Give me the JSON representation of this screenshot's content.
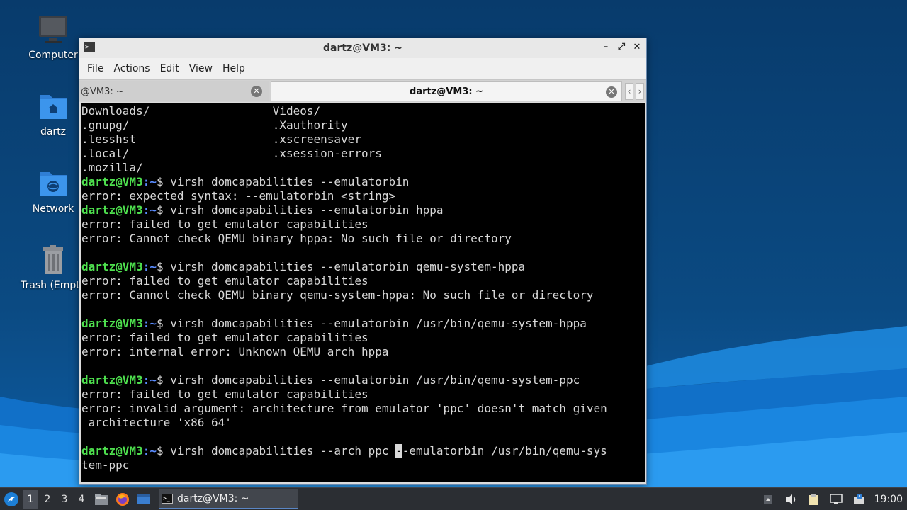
{
  "desktop": {
    "icons": [
      {
        "label": "Computer"
      },
      {
        "label": "dartz"
      },
      {
        "label": "Network"
      },
      {
        "label": "Trash (Empty)"
      }
    ]
  },
  "window": {
    "title": "dartz@VM3: ~",
    "menu": [
      "File",
      "Actions",
      "Edit",
      "View",
      "Help"
    ],
    "tabs": [
      {
        "label": "@VM3: ~",
        "active": false
      },
      {
        "label": "dartz@VM3: ~",
        "active": true
      }
    ],
    "terminal": {
      "user_host": "dartz@VM3",
      "path": ":~",
      "lines": [
        {
          "type": "out",
          "text": "Downloads/                  Videos/"
        },
        {
          "type": "out",
          "text": ".gnupg/                     .Xauthority"
        },
        {
          "type": "out",
          "text": ".lesshst                    .xscreensaver"
        },
        {
          "type": "out",
          "text": ".local/                     .xsession-errors"
        },
        {
          "type": "out",
          "text": ".mozilla/"
        },
        {
          "type": "cmd",
          "text": "$ virsh domcapabilities --emulatorbin"
        },
        {
          "type": "out",
          "text": "error: expected syntax: --emulatorbin <string>"
        },
        {
          "type": "cmd",
          "text": "$ virsh domcapabilities --emulatorbin hppa"
        },
        {
          "type": "out",
          "text": "error: failed to get emulator capabilities"
        },
        {
          "type": "out",
          "text": "error: Cannot check QEMU binary hppa: No such file or directory"
        },
        {
          "type": "out",
          "text": ""
        },
        {
          "type": "cmd",
          "text": "$ virsh domcapabilities --emulatorbin qemu-system-hppa"
        },
        {
          "type": "out",
          "text": "error: failed to get emulator capabilities"
        },
        {
          "type": "out",
          "text": "error: Cannot check QEMU binary qemu-system-hppa: No such file or directory"
        },
        {
          "type": "out",
          "text": ""
        },
        {
          "type": "cmd",
          "text": "$ virsh domcapabilities --emulatorbin /usr/bin/qemu-system-hppa"
        },
        {
          "type": "out",
          "text": "error: failed to get emulator capabilities"
        },
        {
          "type": "out",
          "text": "error: internal error: Unknown QEMU arch hppa"
        },
        {
          "type": "out",
          "text": ""
        },
        {
          "type": "cmd",
          "text": "$ virsh domcapabilities --emulatorbin /usr/bin/qemu-system-ppc"
        },
        {
          "type": "out",
          "text": "error: failed to get emulator capabilities"
        },
        {
          "type": "out",
          "text": "error: invalid argument: architecture from emulator 'ppc' doesn't match given"
        },
        {
          "type": "out",
          "text": " architecture 'x86_64'"
        },
        {
          "type": "out",
          "text": ""
        }
      ],
      "current_before_cursor": "$ virsh domcapabilities --arch ppc ",
      "cursor_char": "-",
      "current_after_cursor": "-emulatorbin /usr/bin/qemu-sys",
      "current_wrap": "tem-ppc"
    }
  },
  "taskbar": {
    "workspaces": [
      "1",
      "2",
      "3",
      "4"
    ],
    "active_workspace": 0,
    "task_label": "dartz@VM3: ~",
    "clock": "19:00"
  },
  "colors": {
    "prompt_user": "#4ee04e",
    "prompt_path": "#5a8cff",
    "terminal_bg": "#000000"
  }
}
